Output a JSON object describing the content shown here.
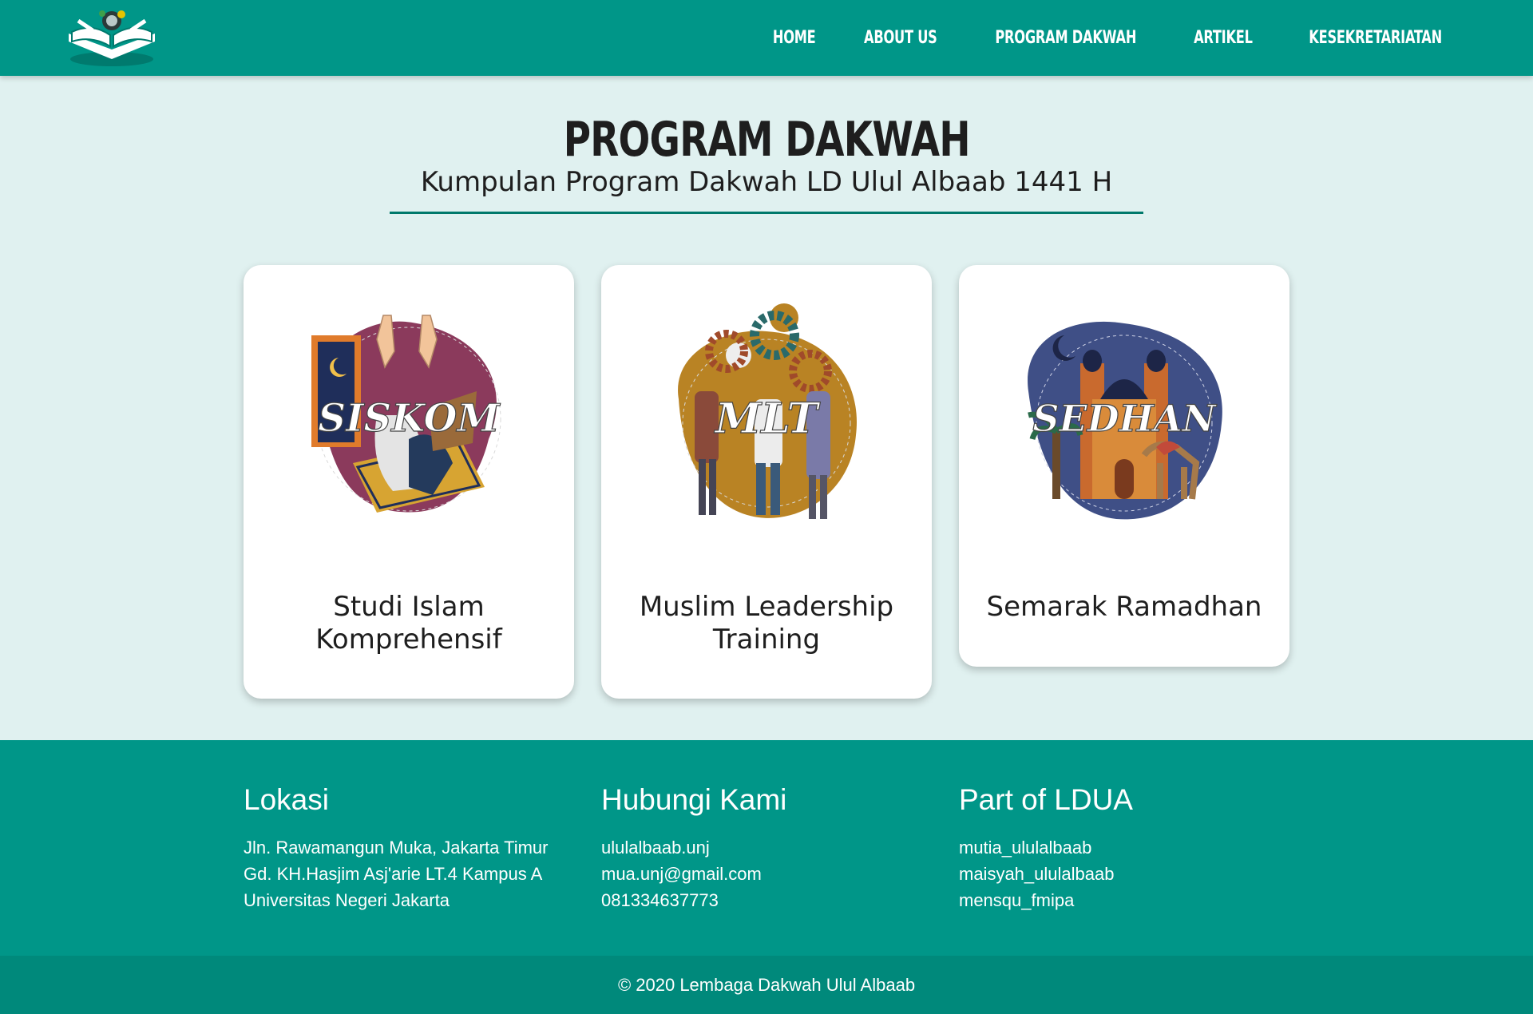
{
  "nav": {
    "home": "HOME",
    "about": "ABOUT US",
    "program": "PROGRAM DAKWAH",
    "artikel": "ARTIKEL",
    "kesekretariatan": "KESEKRETARIATAN"
  },
  "page": {
    "title": "PROGRAM DAKWAH",
    "subtitle": "Kumpulan Program Dakwah LD Ulul Albaab 1441 H"
  },
  "cards": [
    {
      "badge": "SISKOM",
      "label": "Studi Islam Komprehensif",
      "line1": "Studi Islam",
      "line2": "Komprehensif",
      "color": "#8b3a5c"
    },
    {
      "badge": "MLT",
      "label": "Muslim Leadership Training",
      "line1": "Muslim Leadership",
      "line2": "Training",
      "color": "#b98324"
    },
    {
      "badge": "SEDHAN",
      "label": "Semarak Ramadhan",
      "line1": "Semarak Ramadhan",
      "line2": "",
      "color": "#3f4f86"
    }
  ],
  "footer": {
    "lokasi": {
      "title": "Lokasi",
      "lines": [
        "Jln. Rawamangun Muka, Jakarta Timur",
        "Gd. KH.Hasjim Asj'arie LT.4 Kampus A",
        "Universitas Negeri Jakarta"
      ]
    },
    "hubungi": {
      "title": "Hubungi Kami",
      "lines": [
        "ululalbaab.unj",
        "mua.unj@gmail.com",
        "081334637773"
      ]
    },
    "part": {
      "title": "Part of LDUA",
      "lines": [
        "mutia_ululalbaab",
        "maisyah_ululalbaab",
        "mensqu_fmipa"
      ]
    }
  },
  "copyright": "© 2020 Lembaga Dakwah Ulul Albaab",
  "colors": {
    "primary": "#009688",
    "primary_dark": "#00897b",
    "background": "#e0f1f0",
    "underline": "#00796b"
  }
}
